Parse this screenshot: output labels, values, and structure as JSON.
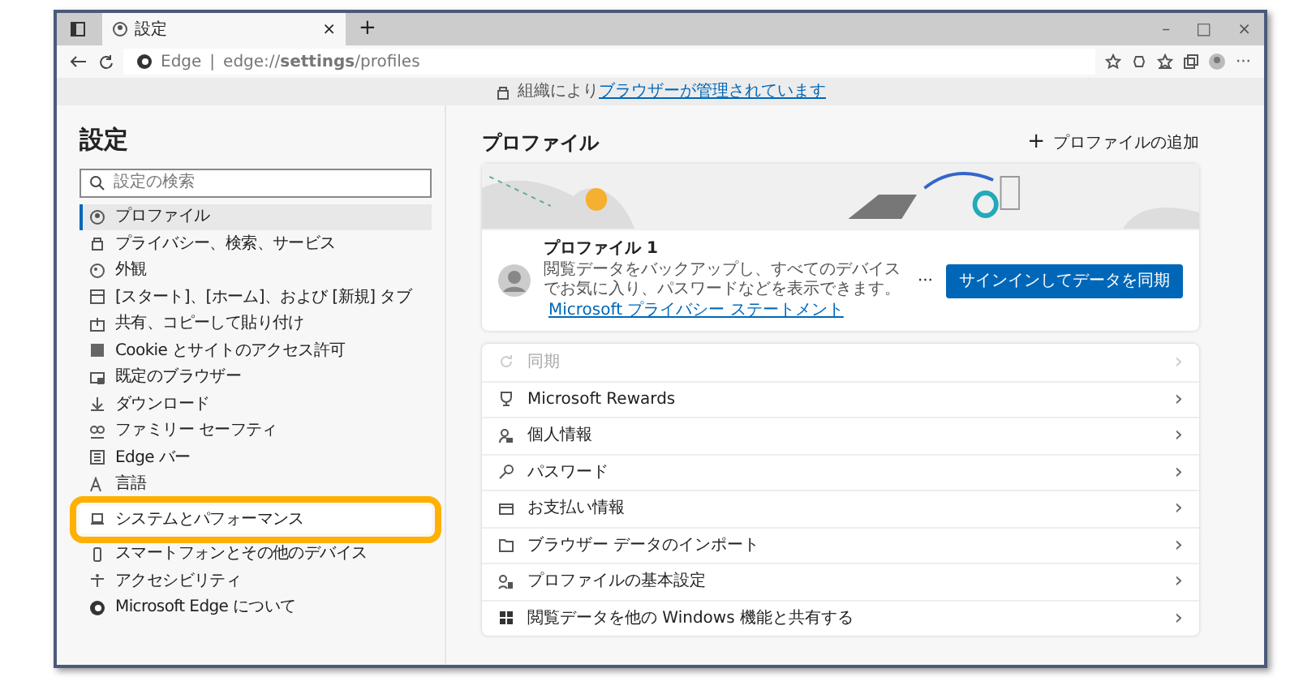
{
  "window": {
    "tab_title": "設定",
    "tab_close": "×",
    "new_tab": "+",
    "controls": [
      "–",
      "□",
      "×"
    ]
  },
  "address_bar": {
    "site_label": "Edge",
    "separator": "|",
    "url": "edge://**settings**/profiles",
    "more": "···"
  },
  "info_bar": {
    "text": "組織により",
    "link": "ブラウザーが管理されています"
  },
  "sidebar": {
    "title": "設定",
    "search": {
      "placeholder": "設定の検索"
    },
    "items": [
      {
        "label": "プロファイル",
        "selected": true,
        "highlighted": false
      },
      {
        "label": "プライバシー、検索、サービス",
        "selected": false,
        "highlighted": false
      },
      {
        "label": "外観",
        "selected": false,
        "highlighted": false
      },
      {
        "label": "[スタート]、[ホーム]、および [新規] タブ",
        "selected": false,
        "highlighted": false
      },
      {
        "label": "共有、コピーして貼り付け",
        "selected": false,
        "highlighted": false
      },
      {
        "label": "Cookie とサイトのアクセス許可",
        "selected": false,
        "highlighted": false
      },
      {
        "label": "既定のブラウザー",
        "selected": false,
        "highlighted": false
      },
      {
        "label": "ダウンロード",
        "selected": false,
        "highlighted": false
      },
      {
        "label": "ファミリー セーフティ",
        "selected": false,
        "highlighted": false
      },
      {
        "label": "Edge バー",
        "selected": false,
        "highlighted": false
      },
      {
        "label": "言語",
        "selected": false,
        "highlighted": false
      },
      {
        "label": "システムとパフォーマンス",
        "selected": false,
        "highlighted": true
      },
      {
        "label": "スマートフォンとその他のデバイス",
        "selected": false,
        "highlighted": false
      },
      {
        "label": "アクセシビリティ",
        "selected": false,
        "highlighted": false
      },
      {
        "label": "Microsoft Edge について",
        "selected": false,
        "highlighted": false
      }
    ]
  },
  "main": {
    "title": "プロファイル",
    "add_profile": "+",
    "add_profile_label": "プロファイルの追加",
    "profile": {
      "name": "プロファイル 1",
      "description": "閲覧データをバックアップし、すべてのデバイスでお気に入り、パスワードなどを表示できます。",
      "link": "Microsoft プライバシー ステートメント",
      "more": "···",
      "button": "サインインしてデータを同期"
    },
    "rows": [
      {
        "label": "同期",
        "disabled": true,
        "chevron": "›"
      },
      {
        "label": "Microsoft Rewards",
        "disabled": false,
        "chevron": "›"
      },
      {
        "label": "個人情報",
        "disabled": false,
        "chevron": "›"
      },
      {
        "label": "パスワード",
        "disabled": false,
        "chevron": "›"
      },
      {
        "label": "お支払い情報",
        "disabled": false,
        "chevron": "›"
      },
      {
        "label": "ブラウザー データのインポート",
        "disabled": false,
        "chevron": "›"
      },
      {
        "label": "プロファイルの基本設定",
        "disabled": false,
        "chevron": "›"
      },
      {
        "label": "閲覧データを他の Windows 機能と共有する",
        "disabled": false,
        "chevron": "›"
      }
    ]
  }
}
